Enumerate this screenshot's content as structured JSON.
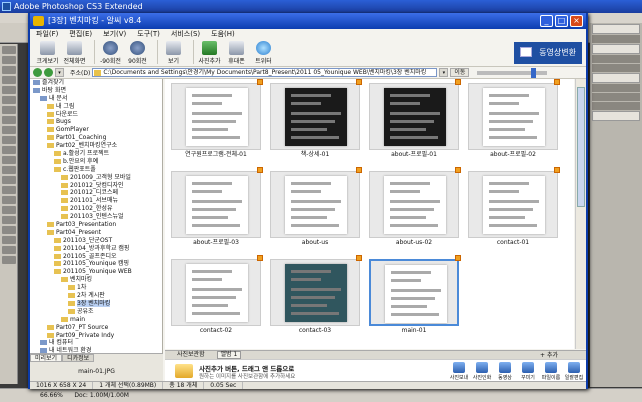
{
  "photoshop": {
    "title": "Adobe Photoshop CS3 Extended",
    "status_zoom": "66.66%",
    "status_doc": "Doc: 1.00M/1.00M"
  },
  "window": {
    "title": "[3장] 벤치마킹 - 알씨 v8.4",
    "menu": [
      "파일(F)",
      "편집(E)",
      "보기(V)",
      "도구(T)",
      "서비스(S)",
      "도움(H)"
    ],
    "toolbar": [
      {
        "label": "크게보기",
        "icon": "view-large-icon"
      },
      {
        "label": "전체화면",
        "icon": "fullscreen-icon"
      },
      {
        "label": "-90회전",
        "icon": "rotate-left-icon"
      },
      {
        "label": "90회전",
        "icon": "rotate-right-icon"
      },
      {
        "label": "보기",
        "icon": "view-icon"
      },
      {
        "label": "사진추가",
        "icon": "add-photo-icon"
      },
      {
        "label": "휴대폰",
        "icon": "phone-icon"
      },
      {
        "label": "트위터",
        "icon": "twitter-icon"
      }
    ],
    "banner": "동영상변환",
    "address_label": "주소(D)",
    "address": "C:\\Documents and Settings\\안경기\\My Documents\\Part8_Present\\2011 05_Younique WEB\\벤치마킹\\3장 벤치마킹",
    "go_label": "이동"
  },
  "tree": [
    {
      "label": "즐겨찾기",
      "level": 0,
      "type": "sys"
    },
    {
      "label": "바탕 화면",
      "level": 0,
      "type": "sys"
    },
    {
      "label": "내 문서",
      "level": 1,
      "type": "sys"
    },
    {
      "label": "내 그림",
      "level": 2
    },
    {
      "label": "다운로드",
      "level": 2
    },
    {
      "label": "Bugs",
      "level": 2
    },
    {
      "label": "GomPlayer",
      "level": 2
    },
    {
      "label": "Part01_Coaching",
      "level": 2
    },
    {
      "label": "Part02_벤치마킹연구소",
      "level": 2
    },
    {
      "label": "a.활성기 프로젝트",
      "level": 3
    },
    {
      "label": "b.안요의 후예",
      "level": 3
    },
    {
      "label": "c.웹판포트폴",
      "level": 3
    },
    {
      "label": "201009_고객형 모바일",
      "level": 4
    },
    {
      "label": "201012_닷컴디자인",
      "level": 4
    },
    {
      "label": "201012_디코스페",
      "level": 4
    },
    {
      "label": "201101_서브매뉴",
      "level": 4
    },
    {
      "label": "201102_한성유",
      "level": 4
    },
    {
      "label": "201103_인텐스뉴얼",
      "level": 4
    },
    {
      "label": "Part03_Presentation",
      "level": 2
    },
    {
      "label": "Part04_Present",
      "level": 2
    },
    {
      "label": "201103_단군OST",
      "level": 3
    },
    {
      "label": "201104_방과후학교 캠핑",
      "level": 3
    },
    {
      "label": "201105_골프존디오",
      "level": 3
    },
    {
      "label": "201105_Younique 캠핑",
      "level": 3
    },
    {
      "label": "201105_Younique WEB",
      "level": 3
    },
    {
      "label": "벤치마킹",
      "level": 4
    },
    {
      "label": "1차",
      "level": 5
    },
    {
      "label": "2차 계시판",
      "level": 5
    },
    {
      "label": "3장 벤치마킹",
      "level": 5,
      "selected": true
    },
    {
      "label": "공유조",
      "level": 5
    },
    {
      "label": "main",
      "level": 4
    },
    {
      "label": "Part07_PT Source",
      "level": 2
    },
    {
      "label": "Part09_Private Indy",
      "level": 2
    },
    {
      "label": "내 컴퓨터",
      "level": 1,
      "type": "sys"
    },
    {
      "label": "내 네트워크 환경",
      "level": 1,
      "type": "sys"
    },
    {
      "label": "휴지통",
      "level": 1,
      "type": "sys"
    }
  ],
  "thumbnails": [
    {
      "name": "연구원프로그램-전체-01",
      "style": "light"
    },
    {
      "name": "책-상세-01",
      "style": "dark"
    },
    {
      "name": "about-프로필-01",
      "style": "dark"
    },
    {
      "name": "about-프로필-02",
      "style": "light"
    },
    {
      "name": "about-프로필-03",
      "style": "light"
    },
    {
      "name": "about-us",
      "style": "light"
    },
    {
      "name": "about-us-02",
      "style": "light"
    },
    {
      "name": "contact-01",
      "style": "light"
    },
    {
      "name": "contact-02",
      "style": "light"
    },
    {
      "name": "contact-03",
      "style": "teal"
    },
    {
      "name": "main-01",
      "style": "light",
      "selected": true
    }
  ],
  "lower_panel": {
    "tabs": [
      "미리보기",
      "디카정보"
    ],
    "filename": "main-01.JPG"
  },
  "slideshow": {
    "tab1": "사진보관함",
    "tab2": "앨범 1",
    "add_label": "+ 추가",
    "msg1": "사진추가 버튼, 드래그 앤 드롭으로",
    "msg2": "원하는 이미지를 사진보관함에 추가하세요",
    "tools": [
      "사진보내기",
      "사진인화",
      "동영상",
      "꾸미기",
      "파일이름",
      "일괄편집"
    ]
  },
  "status": {
    "dims": "1016 X 658 X 24",
    "selection": "1 개체 선택(0.89MB)",
    "count": "총 18 개체",
    "time": "0.05 Sec"
  }
}
